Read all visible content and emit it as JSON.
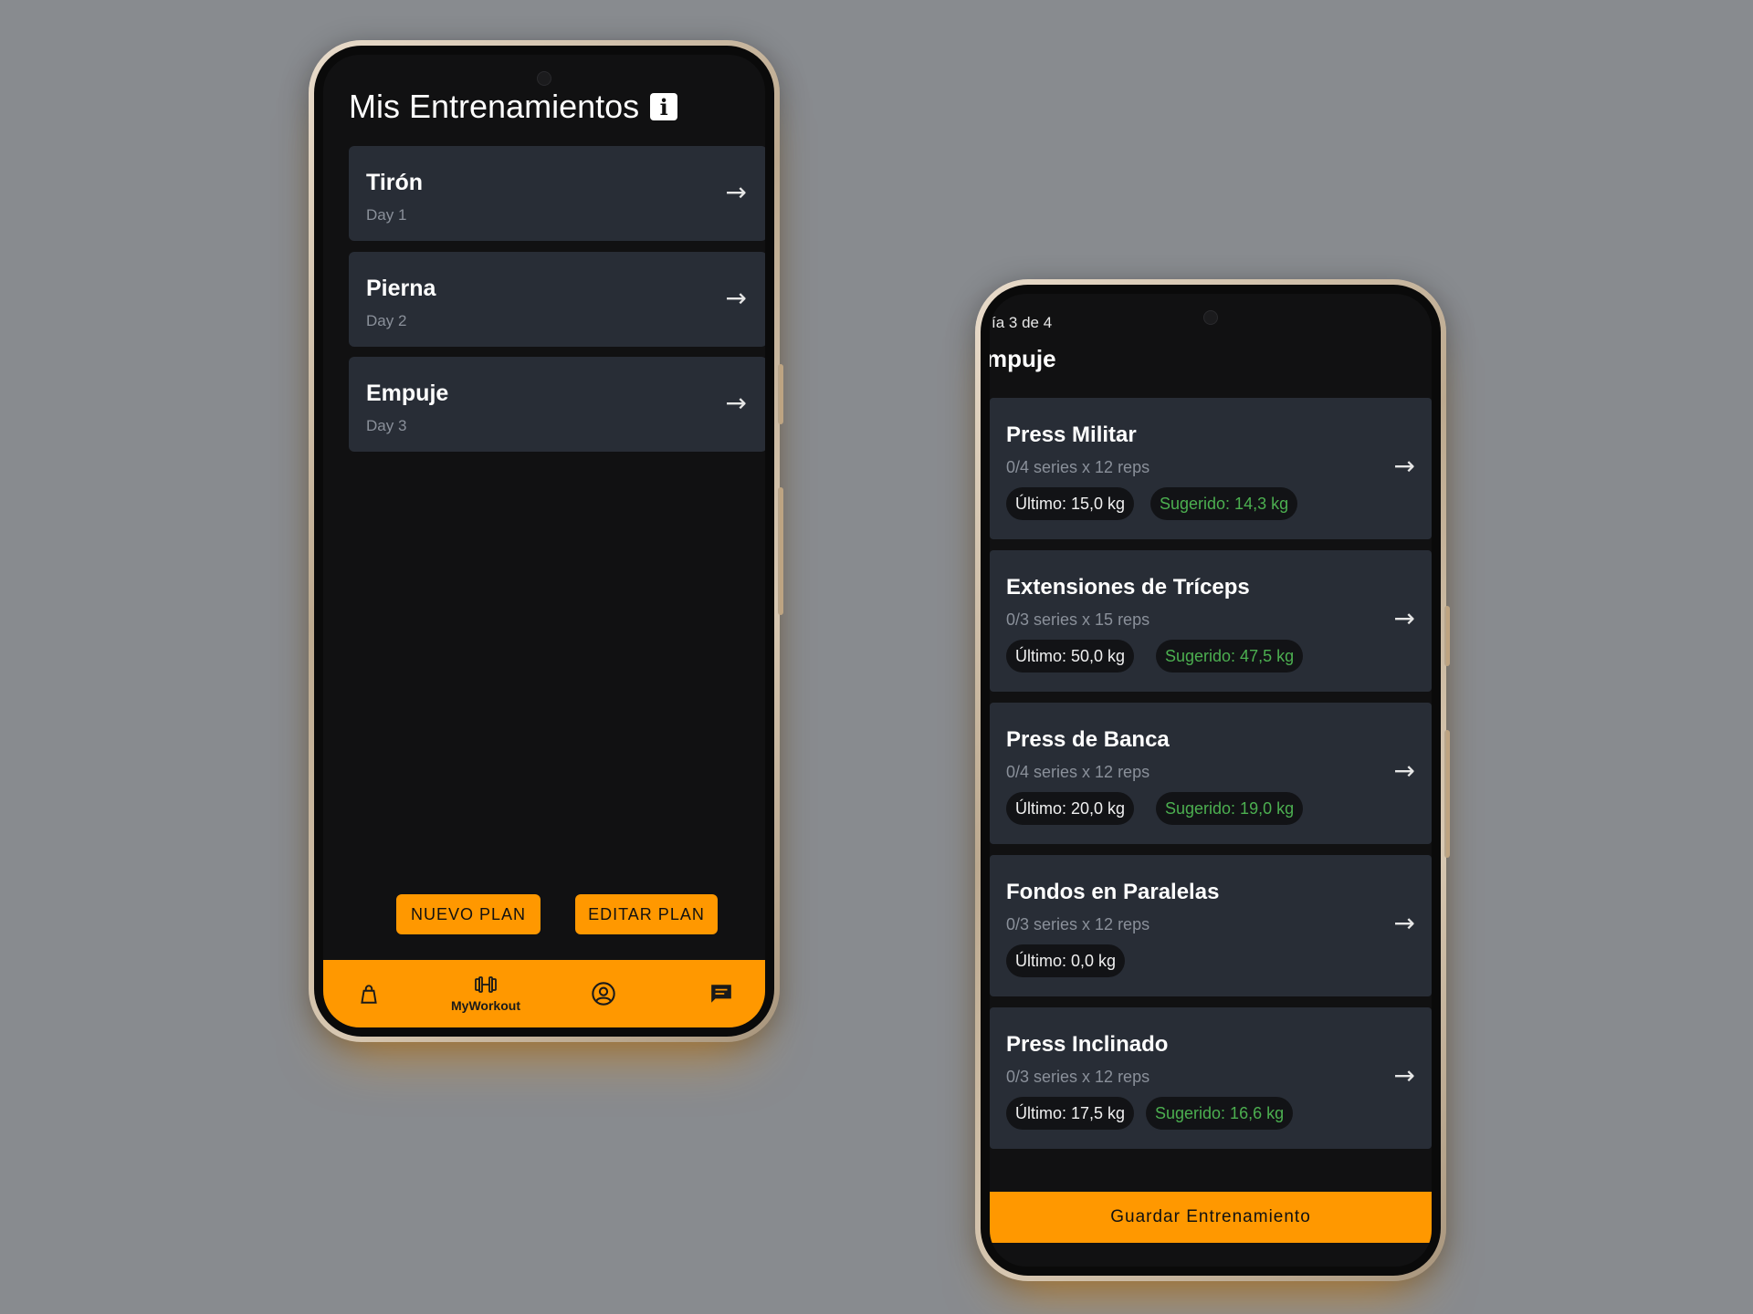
{
  "workouts_screen": {
    "title": "Mis Entrenamientos",
    "info_icon": "info-icon",
    "days": [
      {
        "name": "Tirón",
        "sub": "Day 1"
      },
      {
        "name": "Pierna",
        "sub": "Day 2"
      },
      {
        "name": "Empuje",
        "sub": "Day 3"
      }
    ],
    "buttons": {
      "new_plan": "NUEVO PLAN",
      "edit_plan": "EDITAR PLAN"
    },
    "nav": {
      "items": [
        {
          "icon": "bag-icon",
          "label": ""
        },
        {
          "icon": "dumbbell-icon",
          "label": "MyWorkout"
        },
        {
          "icon": "profile-icon",
          "label": ""
        },
        {
          "icon": "chat-icon",
          "label": ""
        }
      ],
      "active": "MyWorkout"
    }
  },
  "session_screen": {
    "day_progress": "ía 3 de 4",
    "title": "mpuje",
    "exercises": [
      {
        "name": "Press Militar",
        "sets": "0/4 series x 12 reps",
        "last": "Último: 15,0 kg",
        "suggested": "Sugerido: 14,3 kg"
      },
      {
        "name": "Extensiones de Tríceps",
        "sets": "0/3 series x 15 reps",
        "last": "Último: 50,0 kg",
        "suggested": "Sugerido: 47,5 kg"
      },
      {
        "name": "Press de Banca",
        "sets": "0/4 series x 12 reps",
        "last": "Último: 20,0 kg",
        "suggested": "Sugerido: 19,0 kg"
      },
      {
        "name": "Fondos en Paralelas",
        "sets": "0/3 series x 12 reps",
        "last": "Último: 0,0 kg",
        "suggested": ""
      },
      {
        "name": "Press Inclinado",
        "sets": "0/3 series x 12 reps",
        "last": "Último: 17,5 kg",
        "suggested": "Sugerido: 16,6 kg"
      }
    ],
    "save_button": "Guardar Entrenamiento"
  },
  "colors": {
    "accent": "#ff9800",
    "card": "#282d36",
    "screen": "#111112",
    "suggested": "#4caf50",
    "background": "#888b8f"
  }
}
